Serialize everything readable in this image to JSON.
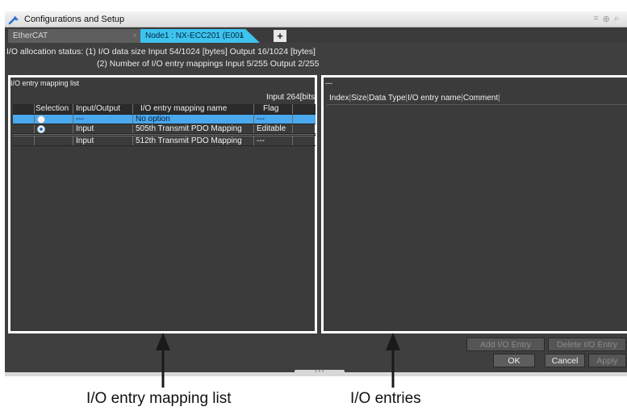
{
  "window": {
    "title": "Configurations and Setup",
    "tools": [
      "⌗",
      "⊕",
      "⌕"
    ]
  },
  "tabs": [
    {
      "label": "EtherCAT",
      "close": "×"
    },
    {
      "label": "Node1 : NX-ECC201 (E001",
      "close": "×"
    }
  ],
  "add_tab": "+",
  "status": {
    "line1": "I/O allocation status: (1) I/O data size Input 54/1024 [bytes] Output 16/1024 [bytes]",
    "line2": "(2) Number of I/O entry mappings Input 5/255 Output 2/255"
  },
  "mapping_list": {
    "title": "I/O entry mapping list",
    "input_bits": "Input 264[bits",
    "columns": [
      "",
      "Selection",
      "Input/Output",
      "I/O entry mapping name",
      "Flag",
      ""
    ],
    "rows": [
      {
        "selected": true,
        "radio": false,
        "io": "---",
        "name": "No option",
        "flag": "---"
      },
      {
        "selected": false,
        "radio": true,
        "io": "Input",
        "name": "505th Transmit PDO Mapping",
        "flag": "Editable"
      },
      {
        "selected": false,
        "radio": null,
        "io": "Input",
        "name": "512th Transmit PDO Mapping",
        "flag": "---"
      }
    ]
  },
  "entries": {
    "title": "---",
    "columns": [
      "Index",
      "Size",
      "Data Type",
      "I/O entry name",
      "Comment"
    ]
  },
  "buttons": {
    "add_entry": "Add I/O Entry",
    "delete_entry": "Delete I/O Entry",
    "ok": "OK",
    "cancel": "Cancel",
    "apply": "Apply"
  },
  "splitter": "• • •",
  "captions": {
    "left": "I/O entry mapping list",
    "right": "I/O entries"
  }
}
